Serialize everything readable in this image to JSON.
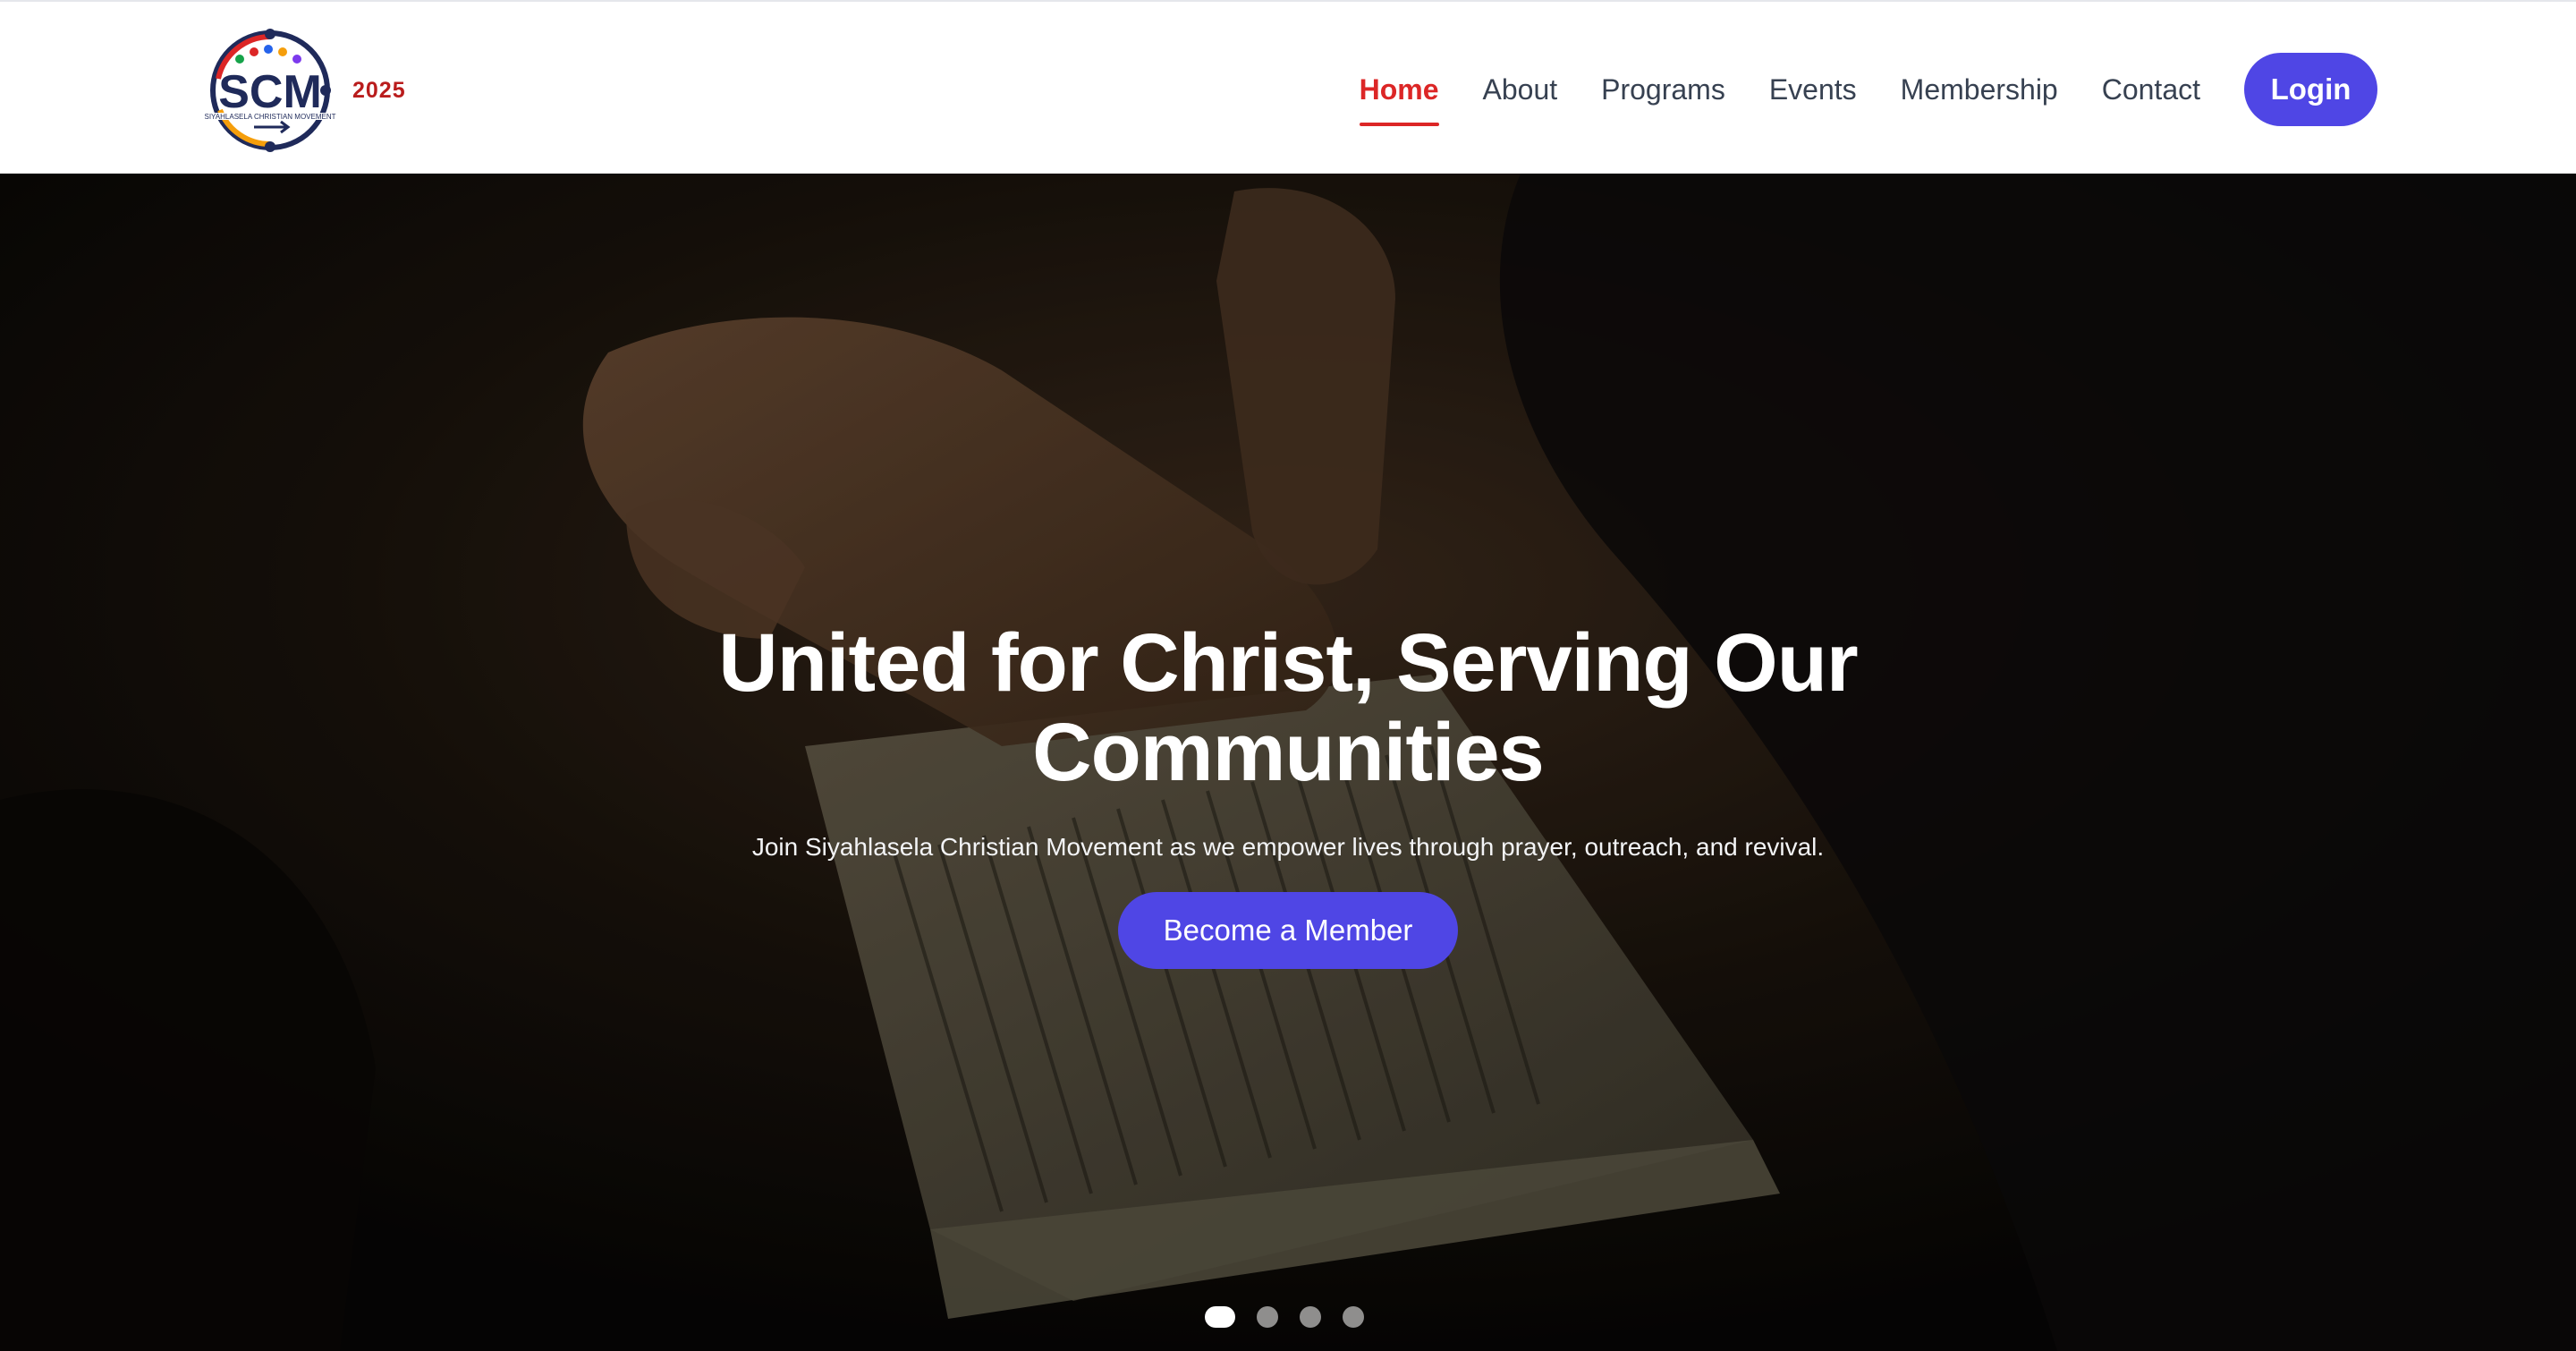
{
  "brand": {
    "logo_text": "SCM",
    "logo_ring_text": "SIYAHLASELA CHRISTIAN MOVEMENT",
    "year": "2025"
  },
  "nav": {
    "items": [
      {
        "label": "Home",
        "active": true
      },
      {
        "label": "About",
        "active": false
      },
      {
        "label": "Programs",
        "active": false
      },
      {
        "label": "Events",
        "active": false
      },
      {
        "label": "Membership",
        "active": false
      },
      {
        "label": "Contact",
        "active": false
      }
    ],
    "login_label": "Login"
  },
  "hero": {
    "title": "United for Christ, Serving Our Communities",
    "subtitle": "Join Siyahlasela Christian Movement as we empower lives through prayer, outreach, and revival.",
    "cta_label": "Become a Member",
    "background": "praying-hands-over-bible-photo"
  },
  "carousel": {
    "slide_count": 4,
    "active_index": 0
  },
  "colors": {
    "accent": "#4f46e5",
    "active_nav": "#dc2626",
    "year_text": "#b91c1c"
  }
}
